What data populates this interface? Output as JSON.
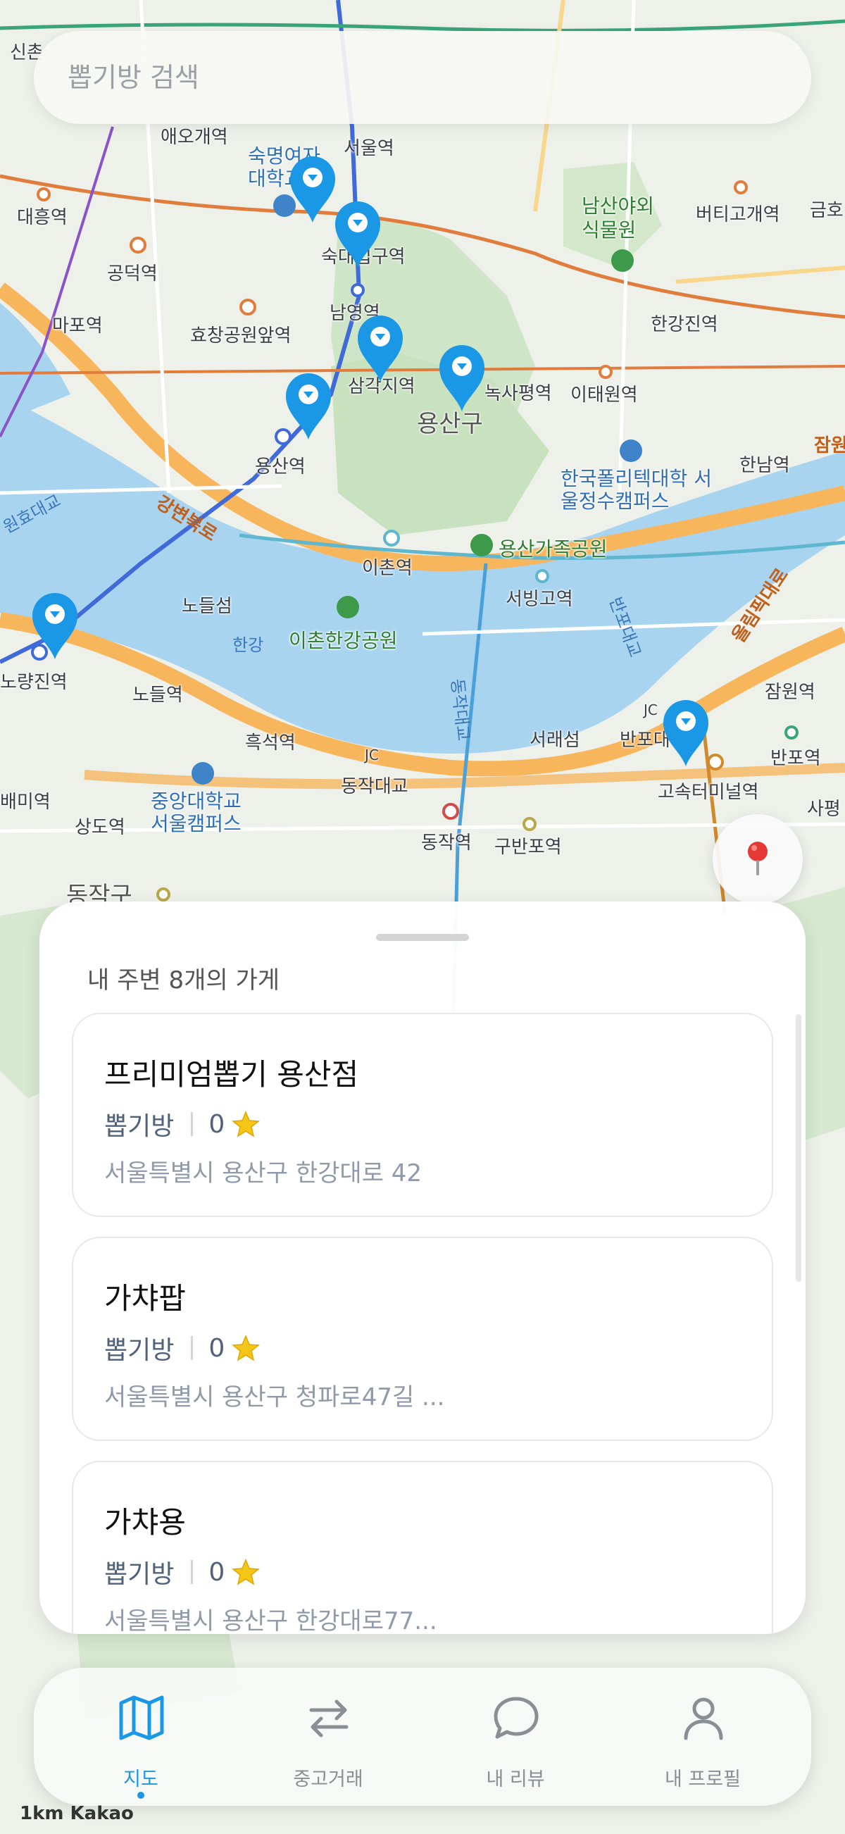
{
  "search": {
    "placeholder": "뽑기방 검색"
  },
  "map": {
    "labels": {
      "sinchon": "신촌",
      "aeogae": "애오개역",
      "seoul_station": "서울역",
      "sookmyung": "숙명여자대학교",
      "daeheung": "대흥역",
      "gongdeok": "공덕역",
      "sookdae": "숙대입구역",
      "mapo": "마포역",
      "hyochang": "효창공원앞역",
      "namyeong": "남영역",
      "namsan": "남산야외식물원",
      "beotigogae": "버티고개역",
      "geumho": "금호",
      "hangangjin": "한강진역",
      "samgakji": "삼각지역",
      "noksapyeong": "녹사평역",
      "itaewon": "이태원역",
      "yongsan_gu": "용산구",
      "yongsan_station": "용산역",
      "jamwon_top": "잠원",
      "wonhyo": "원효대교",
      "gangbyeon": "강변북로",
      "polytech": "한국폴리텍대학 서울정수캠퍼스",
      "hannam": "한남역",
      "ichon": "이촌역",
      "family_park": "용산가족공원",
      "nodeulseom": "노들섬",
      "seobinggo": "서빙고역",
      "banpo_bridge": "반포대교",
      "olympic": "올림픽대로",
      "hangang": "한강",
      "ichon_park": "이촌한강공원",
      "noryangjin": "노량진역",
      "nodeul": "노들역",
      "dongjak_bridge": "동작대교",
      "seoraeseom": "서래섬",
      "banpo": "반포대",
      "jamwon": "잠원역",
      "heukseok": "흑석역",
      "banpo_station": "반포역",
      "express_terminal": "고속터미널역",
      "baemi": "배미역",
      "chungang": "중앙대학교 서울캠퍼스",
      "dongjak_station": "동작역",
      "gubanpo": "구반포역",
      "sangdo": "상도역",
      "dongjak_gu": "동작구",
      "sapyeong": "사평",
      "jc": "JC"
    }
  },
  "location_button": {
    "icon": "location-pin-icon"
  },
  "sheet": {
    "title": "내 주변 8개의 가게",
    "stores": [
      {
        "name": "프리미엄뽑기 용산점",
        "category": "뽑기방",
        "rating": "0",
        "address": "서울특별시 용산구 한강대로 42"
      },
      {
        "name": "가챠팝",
        "category": "뽑기방",
        "rating": "0",
        "address": "서울특별시 용산구 청파로47길 ..."
      },
      {
        "name": "가챠용",
        "category": "뽑기방",
        "rating": "0",
        "address": "서울특별시 용산구 한강대로77..."
      }
    ]
  },
  "nav": {
    "items": [
      {
        "label": "지도",
        "icon": "map-icon",
        "active": true
      },
      {
        "label": "중고거래",
        "icon": "exchange-icon",
        "active": false
      },
      {
        "label": "내 리뷰",
        "icon": "chat-bubble-icon",
        "active": false
      },
      {
        "label": "내 프로필",
        "icon": "user-icon",
        "active": false
      }
    ]
  },
  "colors": {
    "accent": "#1a98e5",
    "pin": "#1a98e5",
    "water": "#a8d4f0",
    "park": "#c8e3c0",
    "road": "#f5b050"
  },
  "scale": "1km  Kakao"
}
